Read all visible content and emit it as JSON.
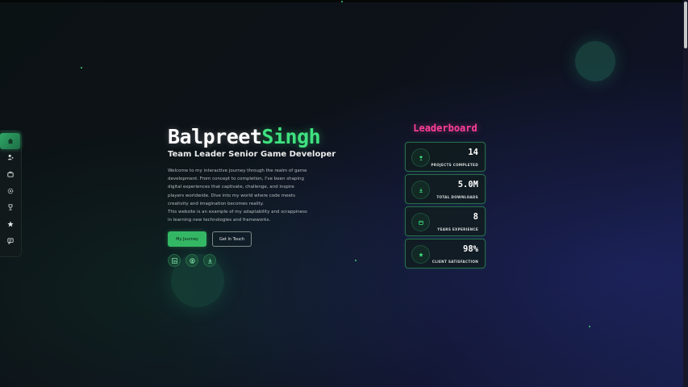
{
  "hero": {
    "first_name": "Balpreet",
    "last_name": "Singh",
    "subtitle": "Team Leader Senior Game Developer",
    "description_1": "Welcome to my interactive journey through the realm of game development. From concept to completion, I've been shaping digital experiences that captivate, challenge, and inspire players worldwide. Dive into my world where code meets creativity and imagination becomes reality.",
    "description_2": "This website is an example of my adaptability and scrappiness in learning new technologies and frameworks.",
    "primary_button": "My Journey",
    "secondary_button": "Get In Touch",
    "social_icons": [
      "linkedin-icon",
      "github-icon",
      "download-icon"
    ]
  },
  "sidebar": {
    "items": [
      {
        "icon": "home-icon",
        "active": true
      },
      {
        "icon": "user-icon",
        "active": false
      },
      {
        "icon": "briefcase-icon",
        "active": false
      },
      {
        "icon": "gear-icon",
        "active": false
      },
      {
        "icon": "trophy-icon",
        "active": false
      },
      {
        "icon": "star-icon",
        "active": false
      },
      {
        "icon": "chat-icon",
        "active": false
      }
    ]
  },
  "leaderboard": {
    "title": "Leaderboard",
    "stats": [
      {
        "value": "14",
        "label": "PROJECTS COMPLETED",
        "icon": "trophy-icon"
      },
      {
        "value": "5.0M",
        "label": "TOTAL DOWNLOADS",
        "icon": "download-icon"
      },
      {
        "value": "8",
        "label": "YEARS EXPERIENCE",
        "icon": "calendar-icon"
      },
      {
        "value": "98%",
        "label": "CLIENT SATISFACTION",
        "icon": "star-icon"
      }
    ]
  },
  "colors": {
    "accent_green": "#3ee27f",
    "accent_pink": "#ff3f9a",
    "background": "#0d1218"
  }
}
